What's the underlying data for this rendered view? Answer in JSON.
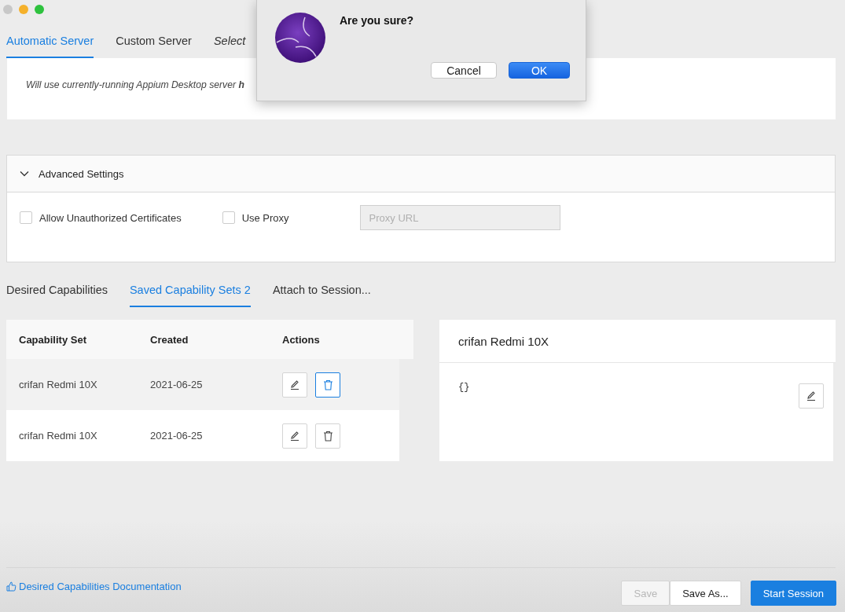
{
  "server_tabs": [
    {
      "label": "Automatic Server",
      "selected": true
    },
    {
      "label": "Custom Server",
      "selected": false
    },
    {
      "label": "Select",
      "selected": false
    }
  ],
  "server_info": "Will use currently-running Appium Desktop server **h**",
  "advanced": {
    "title": "Advanced Settings",
    "expanded": true,
    "options": [
      {
        "label": "Allow Unauthorized Certificates",
        "checked": false
      },
      {
        "label": "Use Proxy",
        "checked": false
      }
    ],
    "proxy": {
      "placeholder": "Proxy URL",
      "disabled": true
    }
  },
  "capability_tabs": [
    {
      "label": "Desired Capabilities",
      "selected": false
    },
    {
      "label": "Saved Capability Sets 2",
      "selected": true
    },
    {
      "label": "Attach to Session...",
      "selected": false
    }
  ],
  "table": {
    "columns": [
      "Capability Set",
      "Created",
      "Actions"
    ],
    "rows": [
      {
        "name": "crifan Redmi 10X",
        "created": "2021-06-25",
        "selected": true
      },
      {
        "name": "crifan Redmi 10X",
        "created": "2021-06-25",
        "selected": false
      }
    ]
  },
  "detail": {
    "title": "crifan Redmi 10X",
    "json": "{}"
  },
  "footer": {
    "link": "Desired Capabilities Documentation",
    "buttons": [
      {
        "label": "Save",
        "kind": "default",
        "disabled": true
      },
      {
        "label": "Save As...",
        "kind": "default",
        "disabled": false
      },
      {
        "label": "Start Session",
        "kind": "primary",
        "disabled": false
      }
    ]
  },
  "dialog": {
    "title": "Are you sure?",
    "buttons": [
      {
        "label": "Cancel",
        "kind": "default"
      },
      {
        "label": "OK",
        "kind": "primary"
      }
    ]
  }
}
